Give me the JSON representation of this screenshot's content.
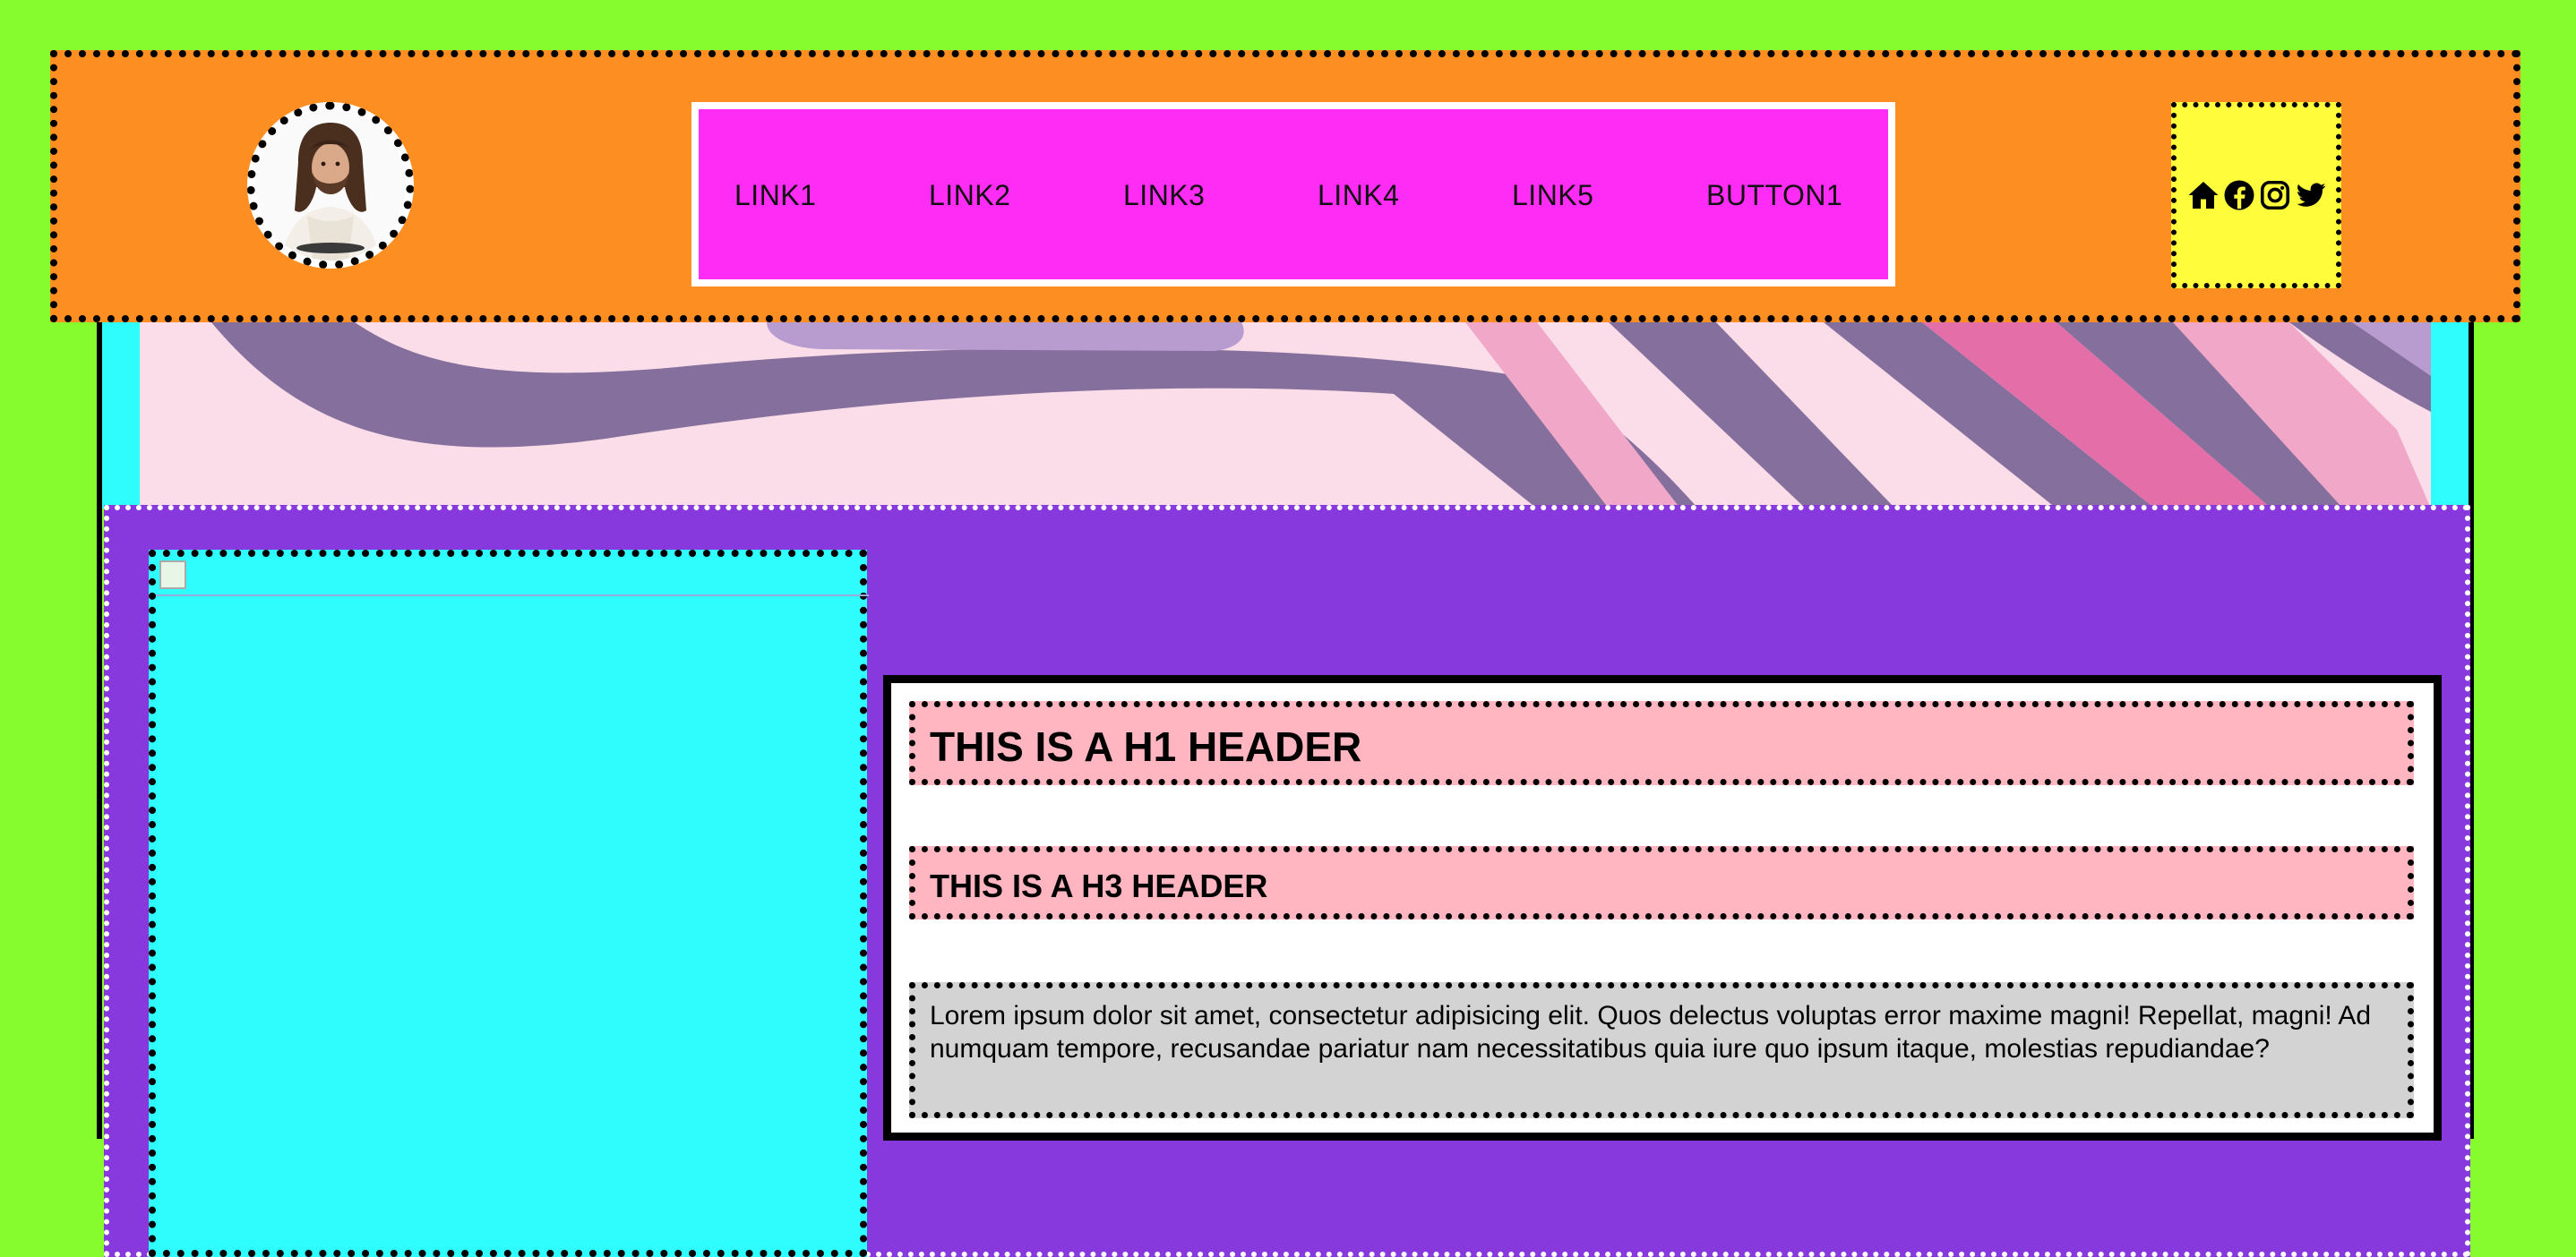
{
  "header": {
    "logo_alt": "avatar",
    "nav": [
      "LINK1",
      "LINK2",
      "LINK3",
      "LINK4",
      "LINK5"
    ],
    "nav_button": "BUTTON1",
    "social_icons": [
      "home-icon",
      "facebook-icon",
      "instagram-icon",
      "twitter-icon"
    ]
  },
  "content": {
    "h1": "THIS IS A H1 HEADER",
    "h3": "THIS IS A H3 HEADER",
    "paragraph": "Lorem ipsum dolor sit amet, consectetur adipisicing elit. Quos delectus voluptas error maxime magni! Repellat, magni! Ad numquam tempore, recusandae pariatur nam necessitatibus quia iure quo ipsum itaque, molestias repudiandae?"
  },
  "colors": {
    "page_bg": "#86fc2e",
    "header_bg": "#fd8e22",
    "nav_bg": "#ff2cf5",
    "social_bg": "#fffd3b",
    "main_bg": "#8839dd",
    "image_box_bg": "#2ffdfd",
    "header_box_bg": "#ffb6c1",
    "paragraph_bg": "#d3d3d3"
  }
}
